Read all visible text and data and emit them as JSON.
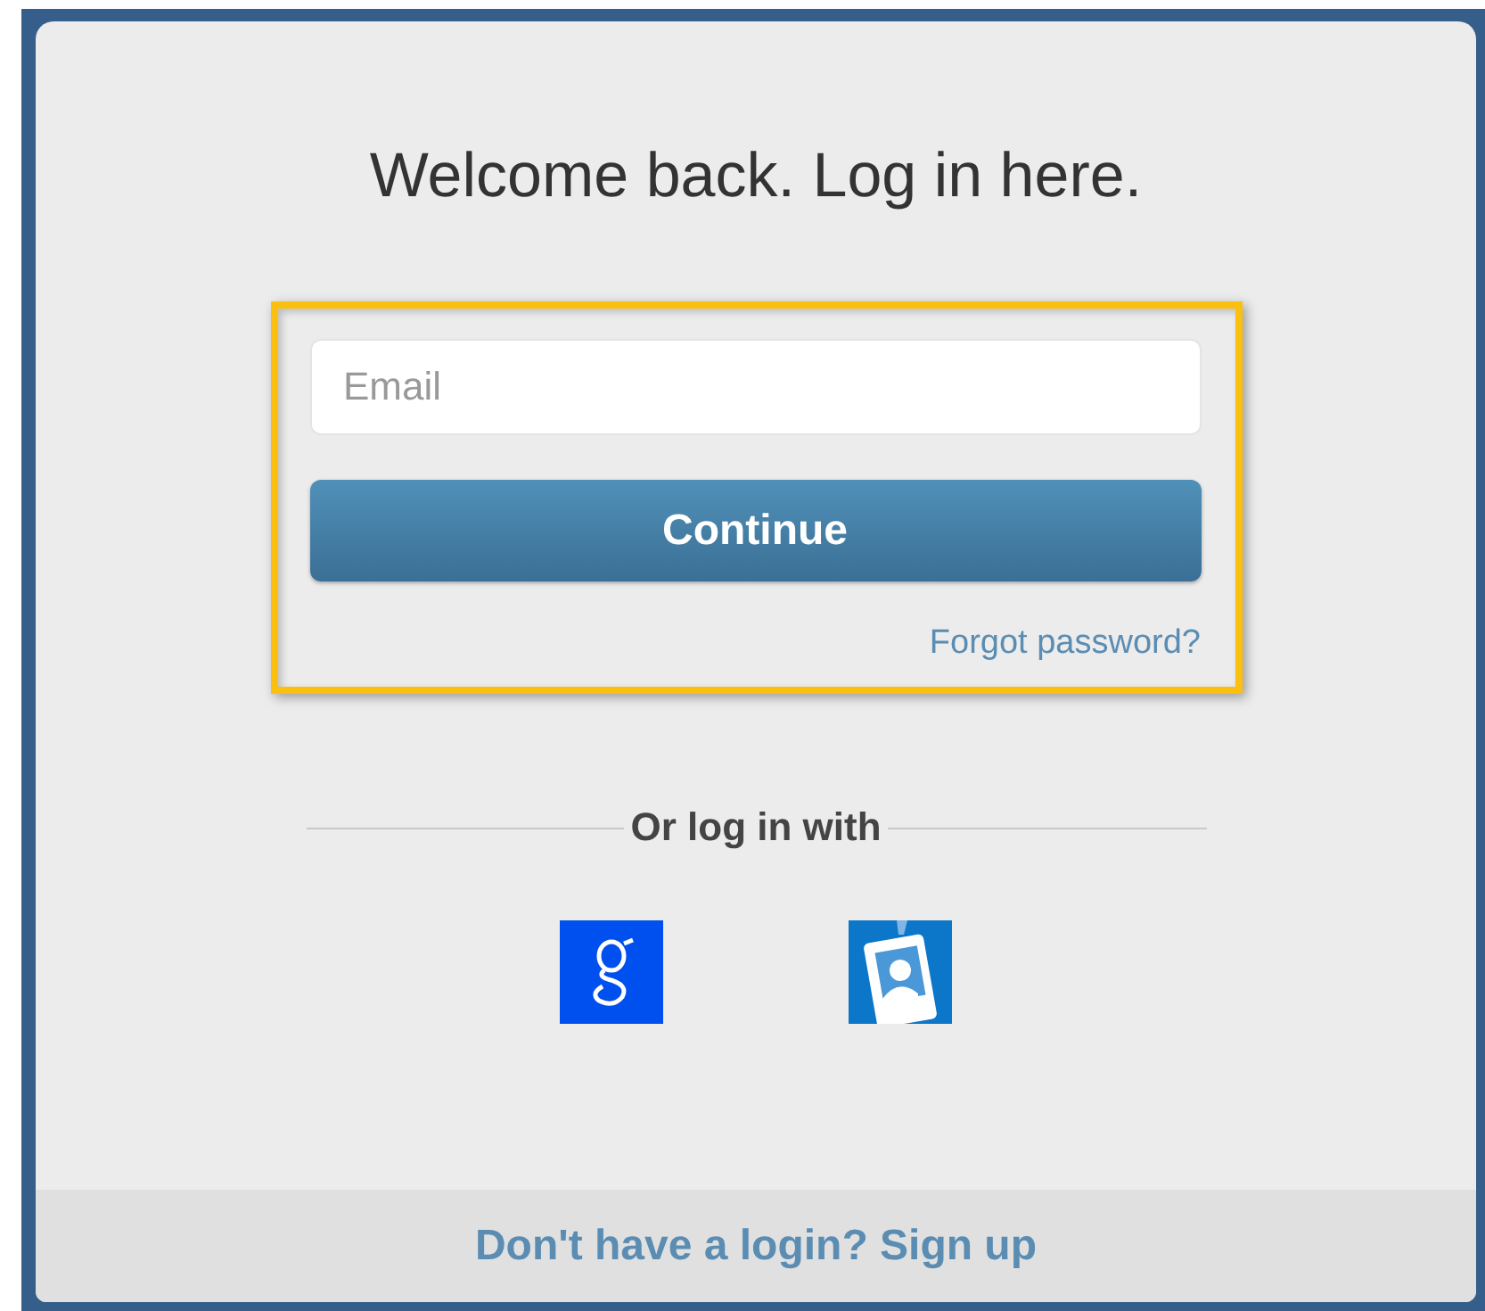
{
  "title": "Welcome back. Log in here.",
  "email_field": {
    "placeholder": "Email"
  },
  "continue_button": "Continue",
  "forgot_link": "Forgot password?",
  "divider_label": "Or log in with",
  "providers": [
    {
      "kind": "google"
    },
    {
      "kind": "badge"
    }
  ],
  "footer_link": "Don't have a login? Sign up"
}
